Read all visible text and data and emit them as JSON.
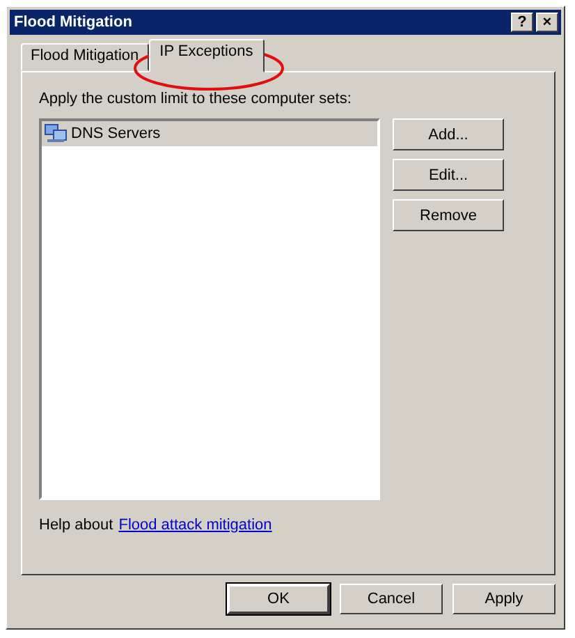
{
  "window": {
    "title": "Flood Mitigation",
    "title_buttons": [
      "?",
      "×"
    ]
  },
  "tabs": [
    {
      "label": "Flood Mitigation",
      "selected": false
    },
    {
      "label": "IP Exceptions",
      "selected": true
    }
  ],
  "prompt": "Apply the custom limit to these computer sets:",
  "list": {
    "items": [
      {
        "label": "DNS Servers",
        "selected": true
      }
    ]
  },
  "side_buttons": [
    "Add...",
    "Edit...",
    "Remove"
  ],
  "help": {
    "text": "Help about",
    "link": "Flood attack mitigation"
  },
  "buttons": [
    {
      "label": "OK",
      "default": true
    },
    {
      "label": "Cancel",
      "default": false
    },
    {
      "label": "Apply",
      "default": false
    }
  ]
}
